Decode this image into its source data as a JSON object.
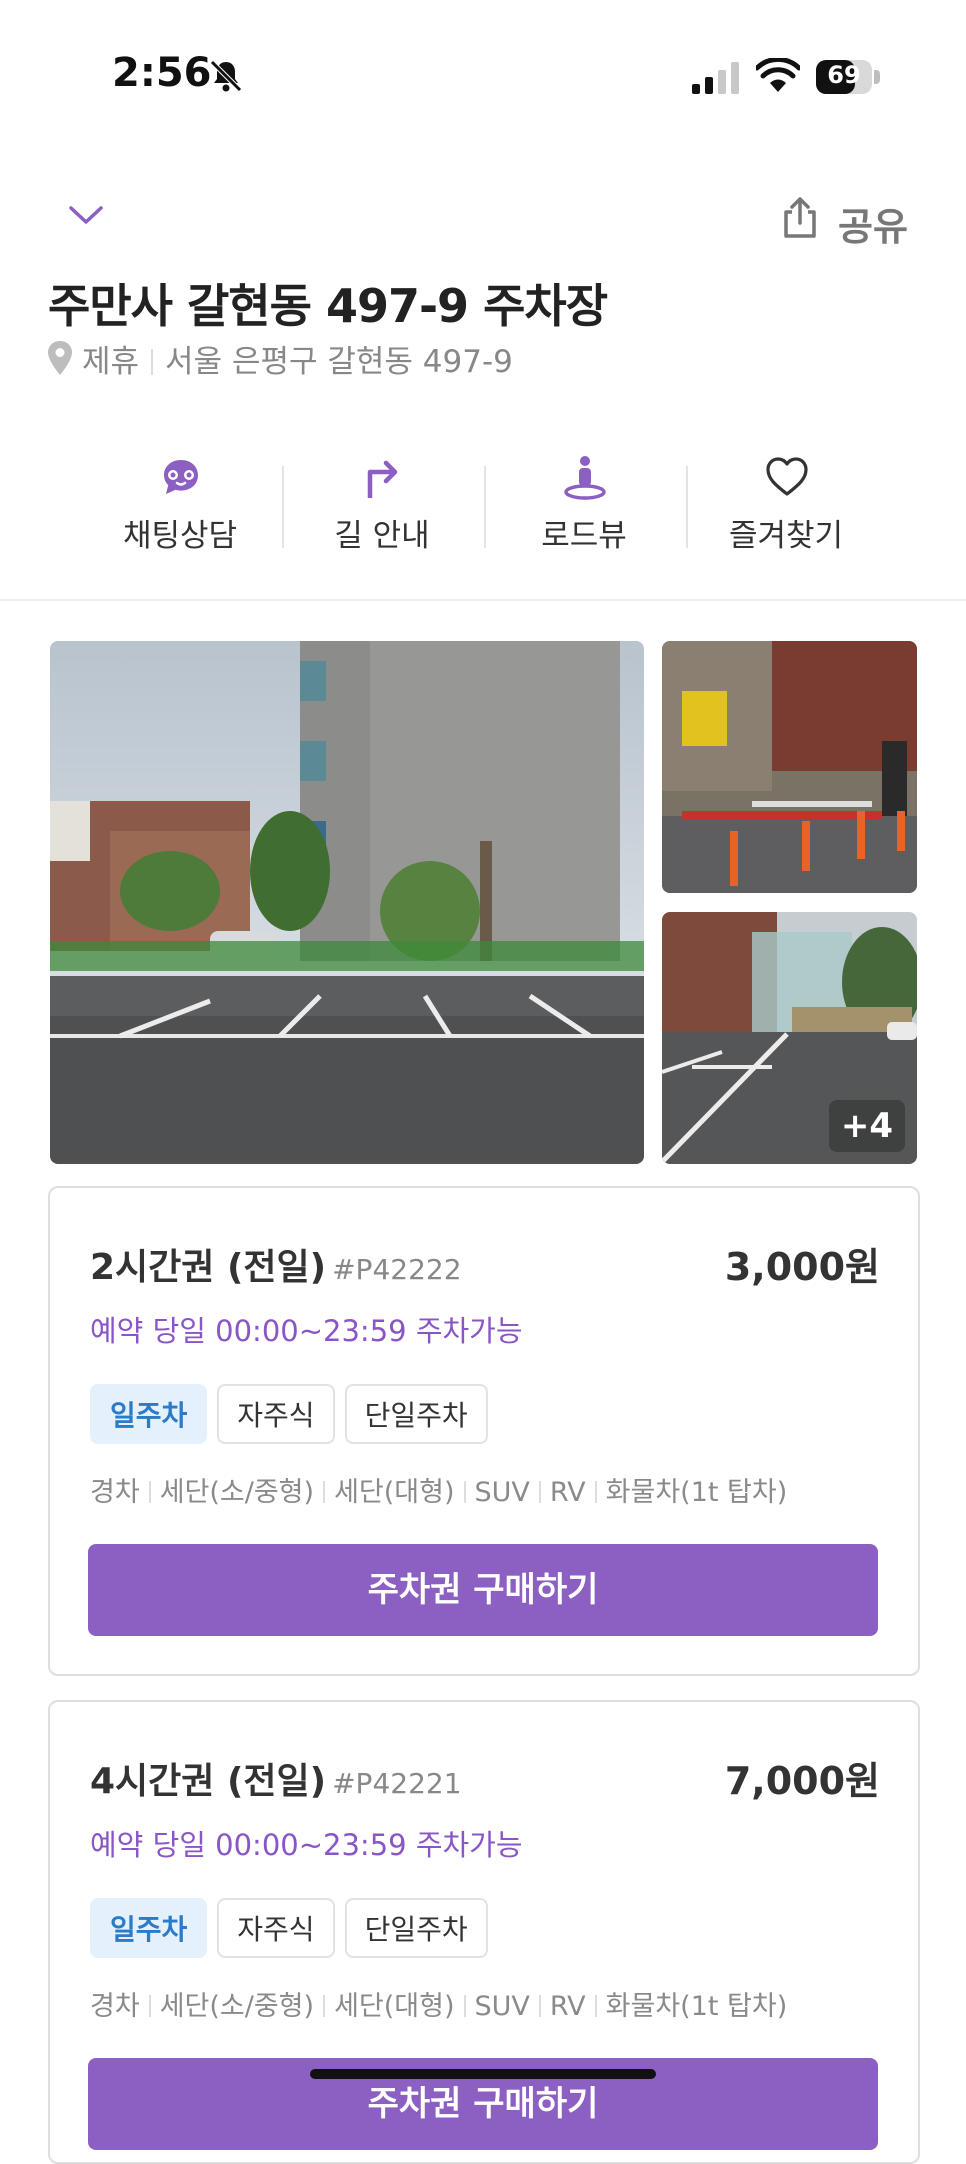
{
  "status_bar": {
    "time": "2:56",
    "battery": "69",
    "battery_level": 0.69
  },
  "header": {
    "share_label": "공유"
  },
  "place": {
    "title": "주만사 갈현동 497-9 주차장",
    "partner": "제휴",
    "address": "서울 은평구 갈현동 497-9"
  },
  "actions": [
    {
      "label": "채팅상담",
      "icon": "chat-bot-icon"
    },
    {
      "label": "길 안내",
      "icon": "turn-right-arrow-icon"
    },
    {
      "label": "로드뷰",
      "icon": "street-view-icon"
    },
    {
      "label": "즐겨찾기",
      "icon": "heart-icon"
    }
  ],
  "photos": {
    "more_count": "+4"
  },
  "tickets": [
    {
      "name": "2시간권 (전일)",
      "code": "#P42222",
      "price": "3,000원",
      "time": "예약 당일 00:00~23:59 주차가능",
      "tags": [
        "일주차",
        "자주식",
        "단일주차"
      ],
      "vehicles": [
        "경차",
        "세단(소/중형)",
        "세단(대형)",
        "SUV",
        "RV",
        "화물차(1t 탑차)"
      ],
      "button": "주차권 구매하기"
    },
    {
      "name": "4시간권 (전일)",
      "code": "#P42221",
      "price": "7,000원",
      "time": "예약 당일 00:00~23:59 주차가능",
      "tags": [
        "일주차",
        "자주식",
        "단일주차"
      ],
      "vehicles": [
        "경차",
        "세단(소/중형)",
        "세단(대형)",
        "SUV",
        "RV",
        "화물차(1t 탑차)"
      ],
      "button": "주차권 구매하기"
    }
  ],
  "colors": {
    "accent": "#8c5fc2",
    "tag_blue_bg": "#e4f0fb",
    "tag_blue_text": "#2b7bc8"
  }
}
